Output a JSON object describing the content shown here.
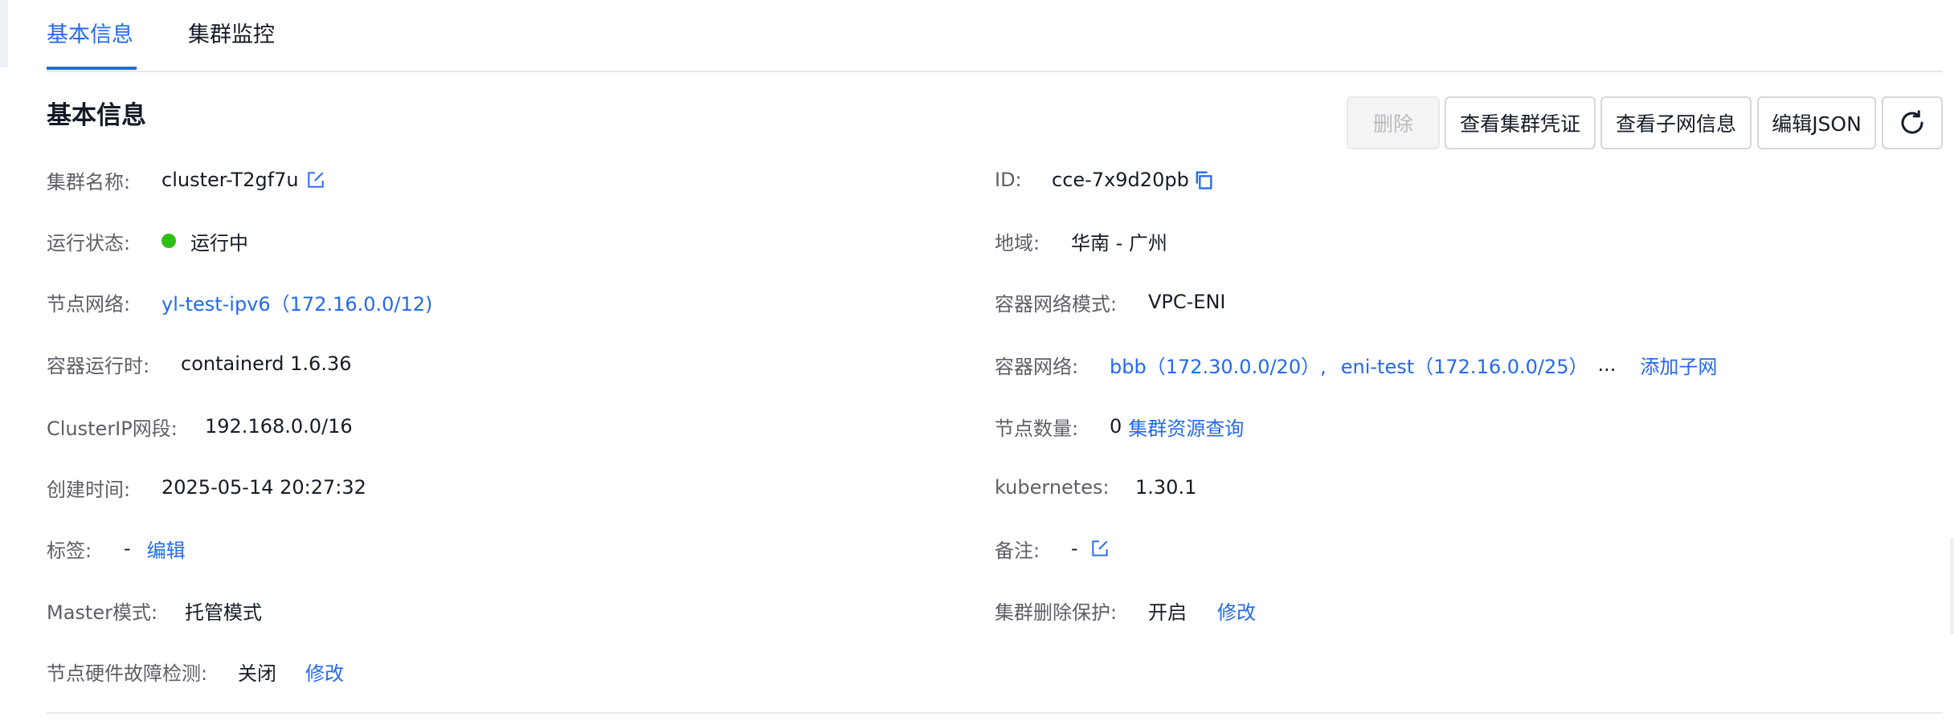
{
  "tabs": [
    {
      "label": "基本信息",
      "active": true
    },
    {
      "label": "集群监控",
      "active": false
    }
  ],
  "section_title": "基本信息",
  "toolbar": {
    "delete_label": "删除",
    "credentials_label": "查看集群凭证",
    "subnet_label": "查看子网信息",
    "json_label": "编辑JSON",
    "refresh_icon": "refresh-icon"
  },
  "left": {
    "cluster_name": {
      "label": "集群名称:",
      "value": "cluster-T2gf7u",
      "icon": "edit-icon"
    },
    "status": {
      "label": "运行状态:",
      "value": "运行中",
      "color": "#30bf13"
    },
    "node_network": {
      "label": "节点网络:",
      "value": "yl-test-ipv6（172.16.0.0/12)"
    },
    "runtime": {
      "label": "容器运行时:",
      "value": "containerd 1.6.36"
    },
    "clusterip": {
      "label": "ClusterIP网段:",
      "value": "192.168.0.0/16"
    },
    "created": {
      "label": "创建时间:",
      "value": "2025-05-14 20:27:32"
    },
    "tags": {
      "label": "标签:",
      "value": "-",
      "action": "编辑"
    },
    "master_mode": {
      "label": "Master模式:",
      "value": "托管模式"
    },
    "hw_detect": {
      "label": "节点硬件故障检测:",
      "value": "关闭",
      "action": "修改"
    }
  },
  "right": {
    "id": {
      "label": "ID:",
      "value": "cce-7x9d20pb",
      "icon": "copy-icon"
    },
    "region": {
      "label": "地域:",
      "value": "华南 - 广州"
    },
    "network_mode": {
      "label": "容器网络模式:",
      "value": "VPC-ENI"
    },
    "container_network": {
      "label": "容器网络:",
      "subnet1": "bbb（172.30.0.0/20）,",
      "subnet2": "eni-test（172.16.0.0/25）",
      "more": "...",
      "action": "添加子网"
    },
    "node_count": {
      "label": "节点数量:",
      "value": "0",
      "action": "集群资源查询"
    },
    "kubernetes": {
      "label": "kubernetes:",
      "value": "1.30.1"
    },
    "remark": {
      "label": "备注:",
      "value": "-",
      "icon": "edit-icon"
    },
    "delete_protect": {
      "label": "集群删除保护:",
      "value": "开启",
      "action": "修改"
    }
  },
  "colors": {
    "accent": "#2468f2",
    "running": "#30bf13"
  }
}
